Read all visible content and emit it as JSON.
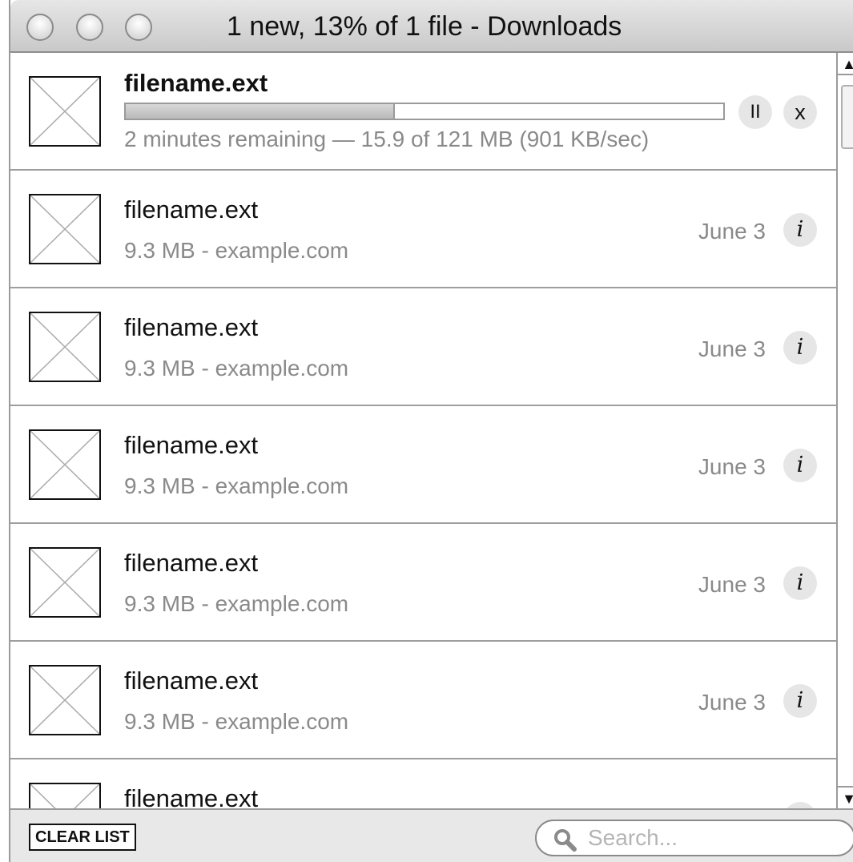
{
  "window": {
    "title": "1 new, 13% of 1 file - Downloads"
  },
  "active_download": {
    "filename": "filename.ext",
    "progress": 0.45,
    "status": "2 minutes remaining — 15.9 of 121 MB (901 KB/sec)",
    "pause_label": "II",
    "cancel_label": "x"
  },
  "downloads": [
    {
      "filename": "filename.ext",
      "details": "9.3 MB - example.com",
      "date": "June 3",
      "info_label": "i"
    },
    {
      "filename": "filename.ext",
      "details": "9.3 MB - example.com",
      "date": "June 3",
      "info_label": "i"
    },
    {
      "filename": "filename.ext",
      "details": "9.3 MB - example.com",
      "date": "June 3",
      "info_label": "i"
    },
    {
      "filename": "filename.ext",
      "details": "9.3 MB - example.com",
      "date": "June 3",
      "info_label": "i"
    },
    {
      "filename": "filename.ext",
      "details": "9.3 MB - example.com",
      "date": "June 3",
      "info_label": "i"
    },
    {
      "filename": "filename.ext",
      "details": "",
      "date": "",
      "info_label": "i"
    }
  ],
  "scrollbar": {
    "up_arrow": "▲",
    "down_arrow": "▼"
  },
  "footer": {
    "clear_label": "CLEAR LIST",
    "search_placeholder": "Search..."
  }
}
